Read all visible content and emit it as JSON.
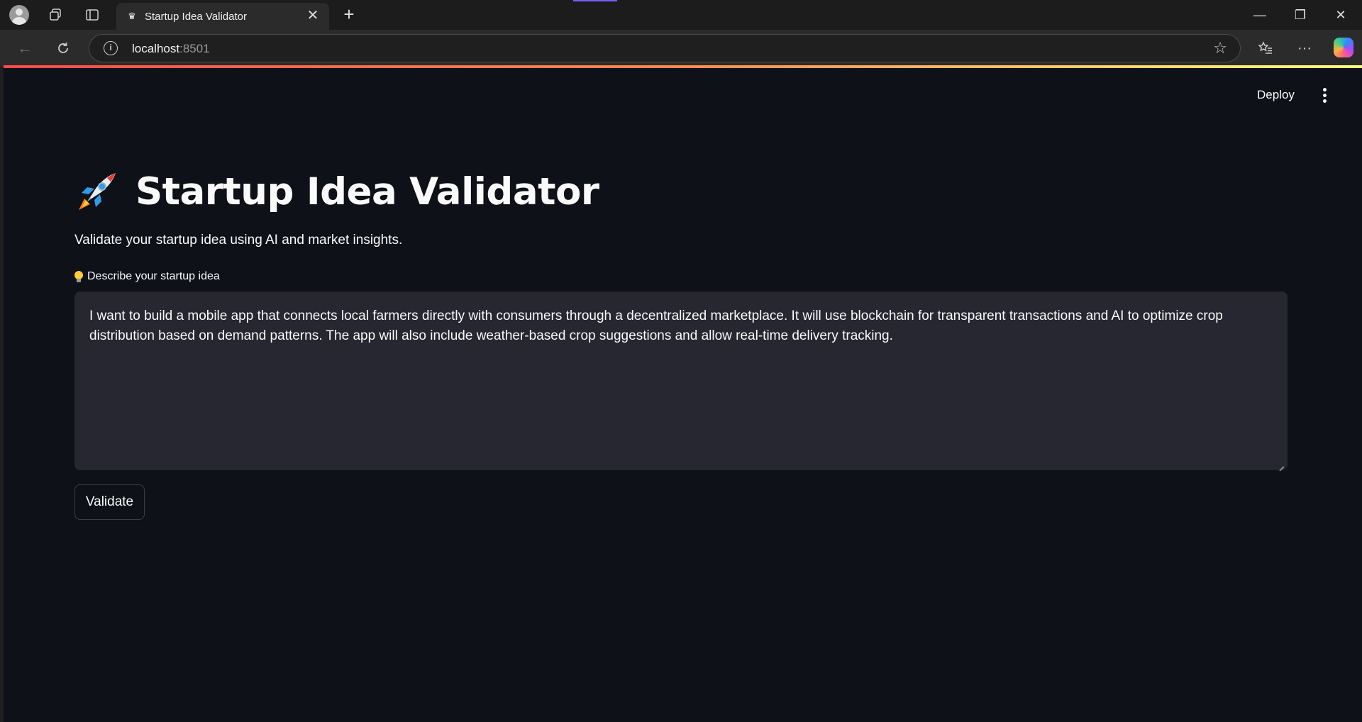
{
  "browser": {
    "tab": {
      "title": "Startup Idea Validator",
      "close_glyph": "✕"
    },
    "new_tab_glyph": "+",
    "address": {
      "host": "localhost",
      "port": ":8501"
    },
    "window_controls": {
      "minimize": "—",
      "restore": "❐",
      "close": "✕"
    },
    "icons": [
      "profile-avatar-icon",
      "workspaces-icon",
      "tab-actions-icon",
      "back-icon",
      "refresh-icon",
      "site-info-icon",
      "favorite-star-icon",
      "favorites-icon",
      "more-icon",
      "copilot-icon"
    ]
  },
  "header": {
    "deploy_label": "Deploy"
  },
  "main": {
    "title": "Startup Idea Validator",
    "title_emoji": "rocket",
    "subtitle": "Validate your startup idea using AI and market insights.",
    "idea_label": "Describe your startup idea",
    "idea_text": "I want to build a mobile app that connects local farmers directly with consumers through a decentralized marketplace. It will use blockchain for transparent transactions and AI to optimize crop distribution based on demand patterns. The app will also include weather-based crop suggestions and allow real-time delivery tracking.",
    "validate_label": "Validate"
  },
  "colors": {
    "background": "#0e1117",
    "input_bg": "#262730",
    "text": "#fafafa",
    "accent_gradient_start": "#ff4b4b",
    "accent_gradient_end": "#fffd80"
  }
}
